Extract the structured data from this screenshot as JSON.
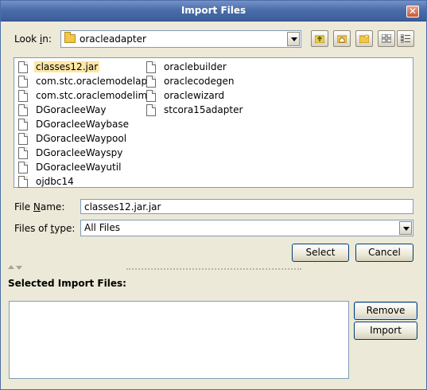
{
  "window": {
    "title": "Import Files"
  },
  "look_in": {
    "label_pre": "Look ",
    "label_mnemonic": "i",
    "label_post": "n:",
    "value": "oracleadapter"
  },
  "toolbar": {
    "buttons": [
      "up-folder-icon",
      "home-folder-icon",
      "new-folder-icon",
      "list-view-icon",
      "details-view-icon"
    ]
  },
  "files": [
    {
      "name": "classes12.jar",
      "selected": true
    },
    {
      "name": "com.stc.oraclemodelapi"
    },
    {
      "name": "com.stc.oraclemodelimpl"
    },
    {
      "name": "DGoracleeWay"
    },
    {
      "name": "DGoracleeWaybase"
    },
    {
      "name": "DGoracleeWaypool"
    },
    {
      "name": "DGoracleeWayspy"
    },
    {
      "name": "DGoracleeWayutil"
    },
    {
      "name": "ojdbc14"
    },
    {
      "name": "oraclebuilder"
    },
    {
      "name": "oraclecodegen"
    },
    {
      "name": "oraclewizard"
    },
    {
      "name": "stcora15adapter"
    }
  ],
  "file_name": {
    "label_pre": "File ",
    "label_mnemonic": "N",
    "label_post": "ame:",
    "value": "classes12.jar.jar"
  },
  "files_of_type": {
    "label_pre": "Files of ",
    "label_mnemonic": "t",
    "label_post": "ype:",
    "value": "All Files"
  },
  "buttons": {
    "select": "Select",
    "cancel": "Cancel",
    "remove": "Remove",
    "import": "Import"
  },
  "selected_panel": {
    "label": "Selected Import Files:"
  }
}
